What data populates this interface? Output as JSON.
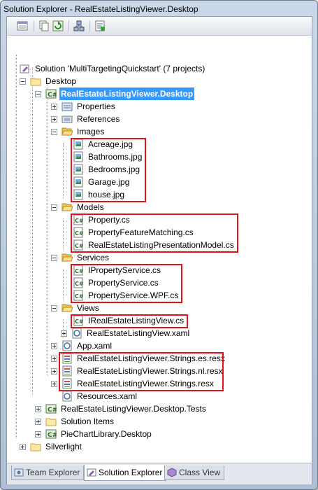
{
  "window": {
    "title": "Solution Explorer - RealEstateListingViewer.Desktop"
  },
  "toolbar": {
    "buttons": [
      {
        "icon": "properties-icon"
      },
      {
        "icon": "show-all-files-icon"
      },
      {
        "icon": "refresh-icon"
      },
      {
        "icon": "class-diagram-icon"
      },
      {
        "icon": "view-code-icon"
      }
    ]
  },
  "tree": {
    "solution": "Solution 'MultiTargetingQuickstart' (7 projects)",
    "desktop": "Desktop",
    "project": "RealEstateListingViewer.Desktop",
    "properties": "Properties",
    "references": "References",
    "images": "Images",
    "image_files": [
      "Acreage.jpg",
      "Bathrooms.jpg",
      "Bedrooms.jpg",
      "Garage.jpg",
      "house.jpg"
    ],
    "models": "Models",
    "model_files": [
      "Property.cs",
      "PropertyFeatureMatching.cs",
      "RealEstateListingPresentationModel.cs"
    ],
    "services": "Services",
    "service_files": [
      "IPropertyService.cs",
      "PropertyService.cs",
      "PropertyService.WPF.cs"
    ],
    "views": "Views",
    "view_files": [
      "IRealEstateListingView.cs",
      "RealEstateListingView.xaml"
    ],
    "app_xaml": "App.xaml",
    "resx_files": [
      "RealEstateListingViewer.Strings.es.resx",
      "RealEstateListingViewer.Strings.nl.resx",
      "RealEstateListingViewer.Strings.resx"
    ],
    "resources_xaml": "Resources.xaml",
    "tests_project": "RealEstateListingViewer.Desktop.Tests",
    "solution_items": "Solution Items",
    "piechart_project": "PieChartLibrary.Desktop",
    "silverlight": "Silverlight"
  },
  "tabs": [
    {
      "label": "Team Explorer",
      "icon": "team-explorer-icon",
      "active": false
    },
    {
      "label": "Solution Explorer",
      "icon": "solution-explorer-icon",
      "active": true
    },
    {
      "label": "Class View",
      "icon": "class-view-icon",
      "active": false
    }
  ],
  "colors": {
    "selection": "#3399ff",
    "highlight_box": "#e0131b",
    "folder": "#f2c65a"
  }
}
